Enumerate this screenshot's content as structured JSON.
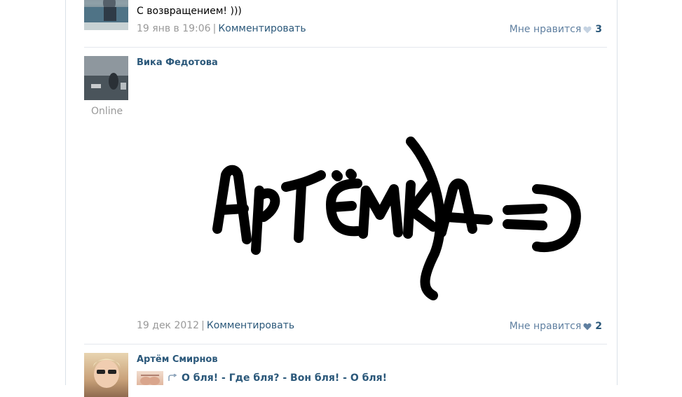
{
  "post1": {
    "text": "С возвращением! )))",
    "date": "19 янв в 19:06",
    "comment_label": "Комментировать",
    "like_label": "Мне нравится",
    "like_count": "3"
  },
  "post2": {
    "author": "Вика Федотова",
    "status": "Online",
    "drawing_text": "АРТЁМКА =)",
    "date": "19 дек 2012",
    "comment_label": "Комментировать",
    "like_label": "Мне нравится",
    "like_count": "2"
  },
  "post3": {
    "author": "Артём Смирнов",
    "repost_text": "О бля! - Где бля? - Вон бля! - О бля!"
  },
  "colors": {
    "link": "#2b587a",
    "meta": "#999999",
    "like": "#5f7fa0",
    "divider": "#e4e8ed"
  },
  "icons": {
    "like": "heart-icon",
    "repost": "repost-arrow-icon"
  }
}
